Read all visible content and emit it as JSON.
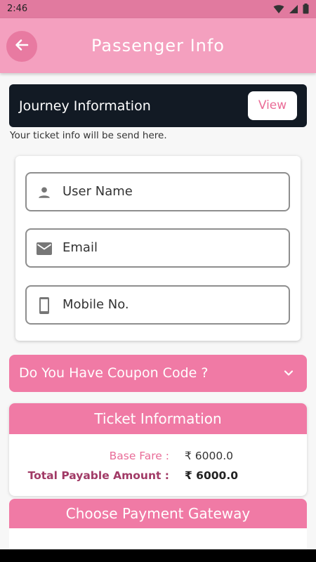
{
  "status_bar": {
    "time": "2:46",
    "icons": [
      "wifi-icon",
      "signal-icon",
      "battery-icon"
    ]
  },
  "app_bar": {
    "title": "Passenger Info",
    "back_icon": "arrow-left-icon"
  },
  "journey": {
    "title": "Journey Information",
    "view_label": "View",
    "note": "Your ticket info will be send here."
  },
  "form": {
    "fields": [
      {
        "icon": "person-icon",
        "placeholder": "User Name"
      },
      {
        "icon": "email-icon",
        "placeholder": "Email"
      },
      {
        "icon": "phone-icon",
        "placeholder": "Mobile No."
      }
    ]
  },
  "coupon": {
    "label": "Do You Have Coupon Code ?",
    "icon": "chevron-down-icon"
  },
  "ticket": {
    "title": "Ticket Information",
    "base_fare_label": "Base Fare :",
    "base_fare_value": "₹ 6000.0",
    "total_label": "Total Payable Amount :",
    "total_value": "₹ 6000.0"
  },
  "payment": {
    "title": "Choose Payment Gateway"
  },
  "colors": {
    "accent": "#f07aa5",
    "app_bar": "#f4a0bf",
    "status_bar": "#e17a9f",
    "journey_bar": "#121a24"
  }
}
